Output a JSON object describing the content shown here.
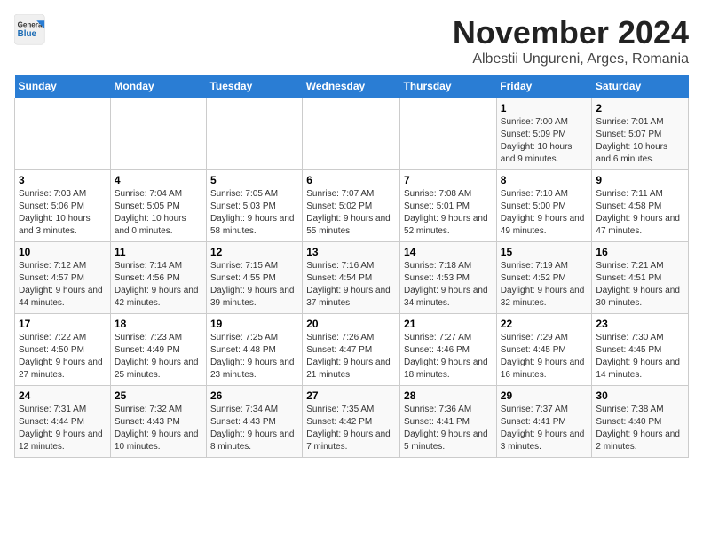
{
  "header": {
    "logo_line1": "General",
    "logo_line2": "Blue",
    "month_title": "November 2024",
    "subtitle": "Albestii Ungureni, Arges, Romania"
  },
  "days_of_week": [
    "Sunday",
    "Monday",
    "Tuesday",
    "Wednesday",
    "Thursday",
    "Friday",
    "Saturday"
  ],
  "weeks": [
    [
      {
        "day": "",
        "info": ""
      },
      {
        "day": "",
        "info": ""
      },
      {
        "day": "",
        "info": ""
      },
      {
        "day": "",
        "info": ""
      },
      {
        "day": "",
        "info": ""
      },
      {
        "day": "1",
        "info": "Sunrise: 7:00 AM\nSunset: 5:09 PM\nDaylight: 10 hours and 9 minutes."
      },
      {
        "day": "2",
        "info": "Sunrise: 7:01 AM\nSunset: 5:07 PM\nDaylight: 10 hours and 6 minutes."
      }
    ],
    [
      {
        "day": "3",
        "info": "Sunrise: 7:03 AM\nSunset: 5:06 PM\nDaylight: 10 hours and 3 minutes."
      },
      {
        "day": "4",
        "info": "Sunrise: 7:04 AM\nSunset: 5:05 PM\nDaylight: 10 hours and 0 minutes."
      },
      {
        "day": "5",
        "info": "Sunrise: 7:05 AM\nSunset: 5:03 PM\nDaylight: 9 hours and 58 minutes."
      },
      {
        "day": "6",
        "info": "Sunrise: 7:07 AM\nSunset: 5:02 PM\nDaylight: 9 hours and 55 minutes."
      },
      {
        "day": "7",
        "info": "Sunrise: 7:08 AM\nSunset: 5:01 PM\nDaylight: 9 hours and 52 minutes."
      },
      {
        "day": "8",
        "info": "Sunrise: 7:10 AM\nSunset: 5:00 PM\nDaylight: 9 hours and 49 minutes."
      },
      {
        "day": "9",
        "info": "Sunrise: 7:11 AM\nSunset: 4:58 PM\nDaylight: 9 hours and 47 minutes."
      }
    ],
    [
      {
        "day": "10",
        "info": "Sunrise: 7:12 AM\nSunset: 4:57 PM\nDaylight: 9 hours and 44 minutes."
      },
      {
        "day": "11",
        "info": "Sunrise: 7:14 AM\nSunset: 4:56 PM\nDaylight: 9 hours and 42 minutes."
      },
      {
        "day": "12",
        "info": "Sunrise: 7:15 AM\nSunset: 4:55 PM\nDaylight: 9 hours and 39 minutes."
      },
      {
        "day": "13",
        "info": "Sunrise: 7:16 AM\nSunset: 4:54 PM\nDaylight: 9 hours and 37 minutes."
      },
      {
        "day": "14",
        "info": "Sunrise: 7:18 AM\nSunset: 4:53 PM\nDaylight: 9 hours and 34 minutes."
      },
      {
        "day": "15",
        "info": "Sunrise: 7:19 AM\nSunset: 4:52 PM\nDaylight: 9 hours and 32 minutes."
      },
      {
        "day": "16",
        "info": "Sunrise: 7:21 AM\nSunset: 4:51 PM\nDaylight: 9 hours and 30 minutes."
      }
    ],
    [
      {
        "day": "17",
        "info": "Sunrise: 7:22 AM\nSunset: 4:50 PM\nDaylight: 9 hours and 27 minutes."
      },
      {
        "day": "18",
        "info": "Sunrise: 7:23 AM\nSunset: 4:49 PM\nDaylight: 9 hours and 25 minutes."
      },
      {
        "day": "19",
        "info": "Sunrise: 7:25 AM\nSunset: 4:48 PM\nDaylight: 9 hours and 23 minutes."
      },
      {
        "day": "20",
        "info": "Sunrise: 7:26 AM\nSunset: 4:47 PM\nDaylight: 9 hours and 21 minutes."
      },
      {
        "day": "21",
        "info": "Sunrise: 7:27 AM\nSunset: 4:46 PM\nDaylight: 9 hours and 18 minutes."
      },
      {
        "day": "22",
        "info": "Sunrise: 7:29 AM\nSunset: 4:45 PM\nDaylight: 9 hours and 16 minutes."
      },
      {
        "day": "23",
        "info": "Sunrise: 7:30 AM\nSunset: 4:45 PM\nDaylight: 9 hours and 14 minutes."
      }
    ],
    [
      {
        "day": "24",
        "info": "Sunrise: 7:31 AM\nSunset: 4:44 PM\nDaylight: 9 hours and 12 minutes."
      },
      {
        "day": "25",
        "info": "Sunrise: 7:32 AM\nSunset: 4:43 PM\nDaylight: 9 hours and 10 minutes."
      },
      {
        "day": "26",
        "info": "Sunrise: 7:34 AM\nSunset: 4:43 PM\nDaylight: 9 hours and 8 minutes."
      },
      {
        "day": "27",
        "info": "Sunrise: 7:35 AM\nSunset: 4:42 PM\nDaylight: 9 hours and 7 minutes."
      },
      {
        "day": "28",
        "info": "Sunrise: 7:36 AM\nSunset: 4:41 PM\nDaylight: 9 hours and 5 minutes."
      },
      {
        "day": "29",
        "info": "Sunrise: 7:37 AM\nSunset: 4:41 PM\nDaylight: 9 hours and 3 minutes."
      },
      {
        "day": "30",
        "info": "Sunrise: 7:38 AM\nSunset: 4:40 PM\nDaylight: 9 hours and 2 minutes."
      }
    ]
  ]
}
